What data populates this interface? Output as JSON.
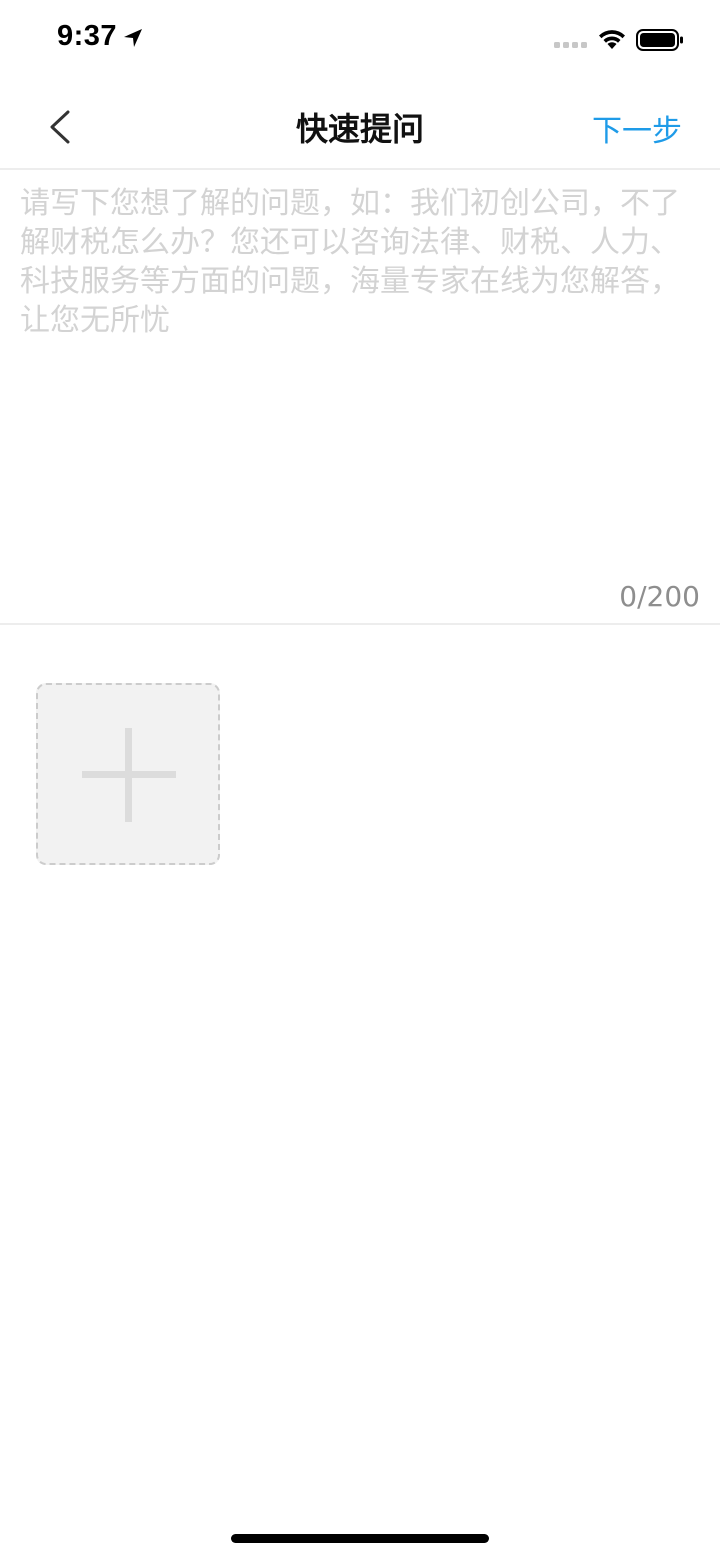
{
  "status_bar": {
    "time": "9:37",
    "icons": [
      "location-arrow-icon",
      "cellular-signal-icon",
      "wifi-icon",
      "battery-icon"
    ]
  },
  "nav": {
    "back_icon": "chevron-left-icon",
    "title": "快速提问",
    "next_label": "下一步"
  },
  "question": {
    "value": "",
    "placeholder": "请写下您想了解的问题，如：我们初创公司，不了解财税怎么办？您还可以咨询法律、财税、人力、科技服务等方面的问题，海量专家在线为您解答，让您无所忧",
    "counter": "0/200"
  },
  "upload": {
    "icon": "plus-icon"
  },
  "colors": {
    "accent": "#1e9be8",
    "placeholder": "#d3d3d3",
    "counter": "#8e8e8e",
    "divider": "#ededed",
    "upload_bg": "#f2f2f2"
  }
}
